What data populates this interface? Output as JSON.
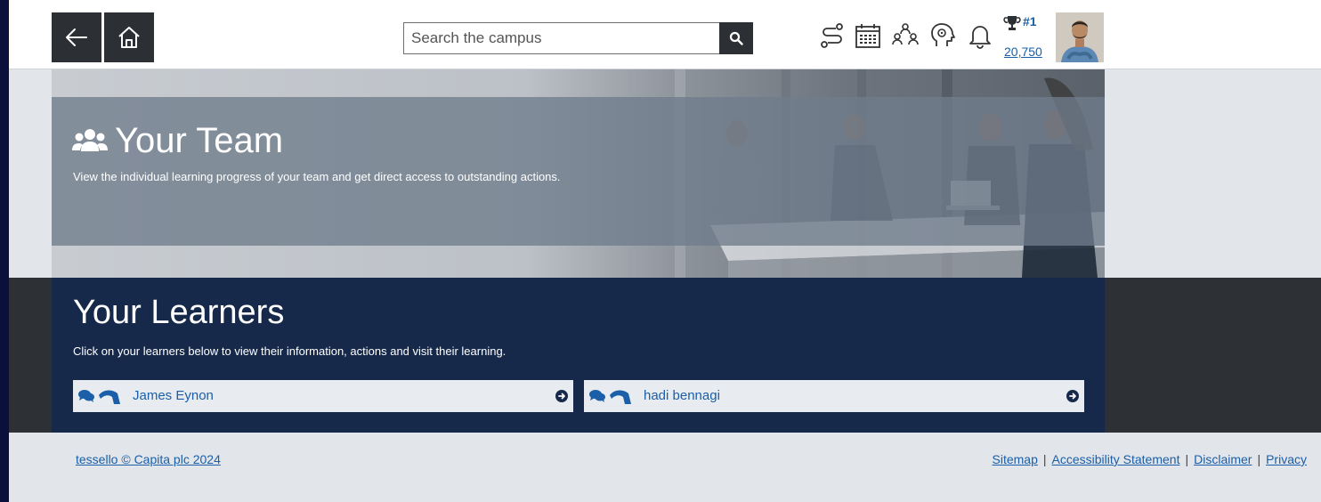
{
  "header": {
    "back_icon": "arrow-left-icon",
    "home_icon": "home-icon",
    "search": {
      "placeholder": "Search the campus",
      "value": ""
    },
    "icons": [
      "route-icon",
      "calendar-icon",
      "team-icon",
      "brain-icon",
      "bell-icon"
    ],
    "leaderboard": {
      "rank": "#1",
      "points": "20,750"
    }
  },
  "banner": {
    "title": "Your Team",
    "subtitle": "View the individual learning progress of your team and get direct access to outstanding actions."
  },
  "learners": {
    "title": "Your Learners",
    "subtitle": "Click on your learners below to view their information, actions and visit their learning.",
    "items": [
      {
        "name": "James Eynon"
      },
      {
        "name": "hadi bennagi"
      }
    ]
  },
  "footer": {
    "copyright": "tessello © Capita plc 2024",
    "links": [
      "Sitemap",
      "Accessibility Statement",
      "Disclaimer",
      "Privacy"
    ]
  },
  "colors": {
    "accent_link": "#1a5fa8",
    "nav_dark": "#2c2f33",
    "learners_bg": "#16294a",
    "page_bg": "#e2e5e9",
    "outer_bg": "#0a0f3c"
  }
}
